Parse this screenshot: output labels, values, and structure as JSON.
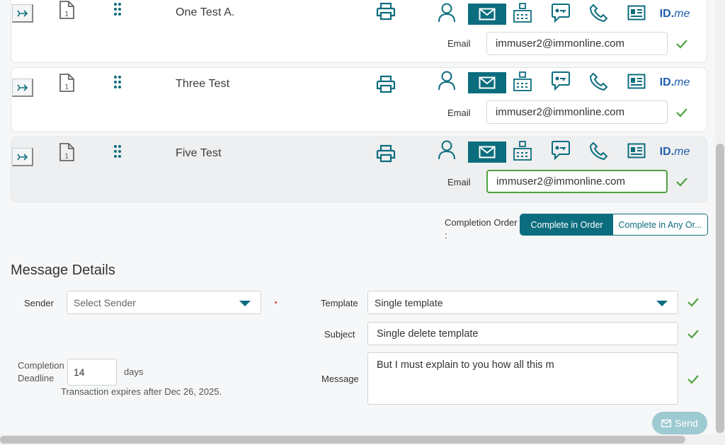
{
  "recipients": [
    {
      "name": "One Test A.",
      "email_label": "Email",
      "email": "immuser2@immonline.com"
    },
    {
      "name": "Three Test",
      "email_label": "Email",
      "email": "immuser2@immonline.com"
    },
    {
      "name": "Five Test",
      "email_label": "Email",
      "email": "immuser2@immonline.com"
    }
  ],
  "delivery_methods": [
    "person-icon",
    "email-icon",
    "fax-icon",
    "sms-icon",
    "phone-icon",
    "id-card-icon",
    "idme-logo"
  ],
  "idme": {
    "id": "ID.",
    "me": "me"
  },
  "completion_order": {
    "label": "Completion Order",
    "colon": ":",
    "options": [
      "Complete in Order",
      "Complete in Any Or..."
    ],
    "selected": "Complete in Order"
  },
  "message_details": {
    "title": "Message Details",
    "sender": {
      "label": "Sender",
      "placeholder": "Select Sender"
    },
    "template": {
      "label": "Template",
      "value": "Single template"
    },
    "subject": {
      "label": "Subject",
      "value": "Single delete template"
    },
    "message": {
      "label": "Message",
      "value": "But I must explain to you how all this m"
    },
    "deadline": {
      "label_line1": "Completion",
      "label_line2": "Deadline",
      "value": "14",
      "unit": "days",
      "note": "Transaction expires after Dec 26, 2025."
    }
  },
  "send_label": "Send",
  "colors": {
    "accent": "#0c6d7e",
    "success": "#4ea33e",
    "send_disabled": "#9ecad1",
    "idme_blue": "#1f5fad"
  }
}
